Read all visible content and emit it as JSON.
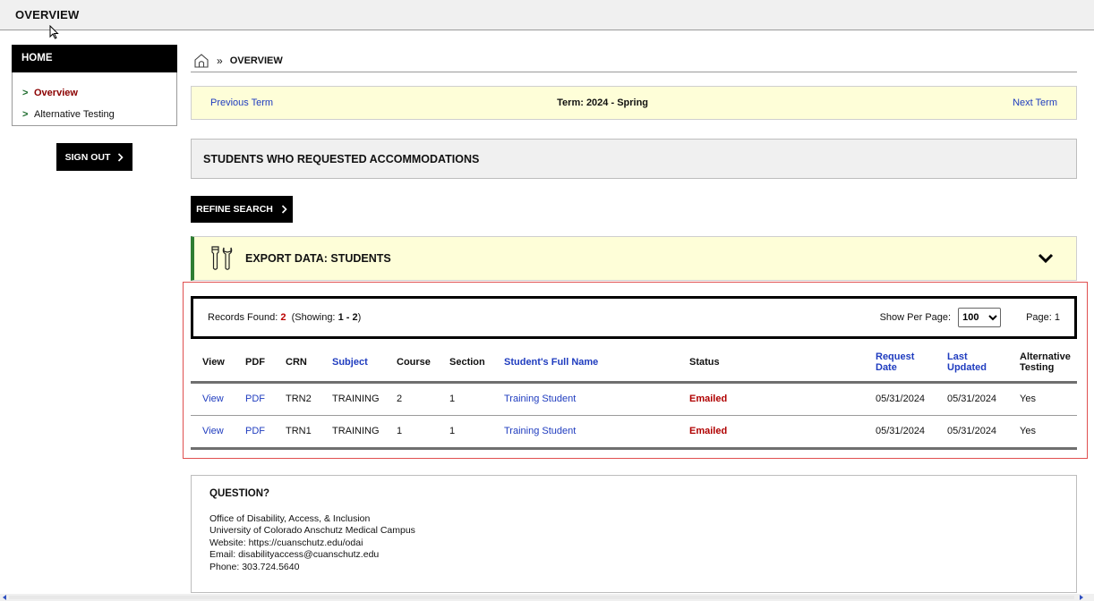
{
  "window": {
    "title": "OVERVIEW"
  },
  "sidebar": {
    "home_label": "HOME",
    "items": [
      {
        "label": "Overview",
        "active": true
      },
      {
        "label": "Alternative Testing",
        "active": false
      }
    ],
    "sign_out_label": "SIGN OUT"
  },
  "breadcrumb": {
    "separator": "»",
    "current": "OVERVIEW"
  },
  "term": {
    "prev_label": "Previous Term",
    "current_label": "Term: 2024 - Spring",
    "next_label": "Next Term"
  },
  "section": {
    "title": "STUDENTS WHO REQUESTED ACCOMMODATIONS"
  },
  "refine": {
    "label": "REFINE SEARCH"
  },
  "export": {
    "label": "EXPORT DATA: STUDENTS"
  },
  "records": {
    "found_label": "Records Found:",
    "found_count": "2",
    "showing_prefix": "(Showing:",
    "showing_range": "1 - 2",
    "showing_suffix": ")",
    "per_page_label": "Show Per Page:",
    "per_page_value": "100",
    "page_label": "Page: 1"
  },
  "table": {
    "columns": [
      "View",
      "PDF",
      "CRN",
      "Subject",
      "Course",
      "Section",
      "Student's Full Name",
      "Status",
      "Request Date",
      "Last Updated",
      "Alternative Testing"
    ],
    "rows": [
      {
        "view": "View",
        "pdf": "PDF",
        "crn": "TRN2",
        "subject": "TRAINING",
        "course": "2",
        "section": "1",
        "name": "Training Student",
        "status": "Emailed",
        "request_date": "05/31/2024",
        "last_updated": "05/31/2024",
        "alt_testing": "Yes"
      },
      {
        "view": "View",
        "pdf": "PDF",
        "crn": "TRN1",
        "subject": "TRAINING",
        "course": "1",
        "section": "1",
        "name": "Training Student",
        "status": "Emailed",
        "request_date": "05/31/2024",
        "last_updated": "05/31/2024",
        "alt_testing": "Yes"
      }
    ]
  },
  "question": {
    "heading": "QUESTION?",
    "lines": [
      "Office of Disability, Access, & Inclusion",
      "University of Colorado Anschutz Medical Campus",
      "Website: https://cuanschutz.edu/odai",
      "Email: disabilityaccess@cuanschutz.edu",
      "Phone: 303.724.5640"
    ]
  },
  "colors": {
    "link": "#1f3cbf",
    "status": "#b00000",
    "active_nav": "#8b0000",
    "accent_green": "#2e7d32",
    "highlight_bg": "#fefed8",
    "selection_outline": "#e05050"
  },
  "icons": [
    "home-icon",
    "tools-icon",
    "chevron-down-icon",
    "chevron-right-icon",
    "mouse-cursor-icon"
  ]
}
